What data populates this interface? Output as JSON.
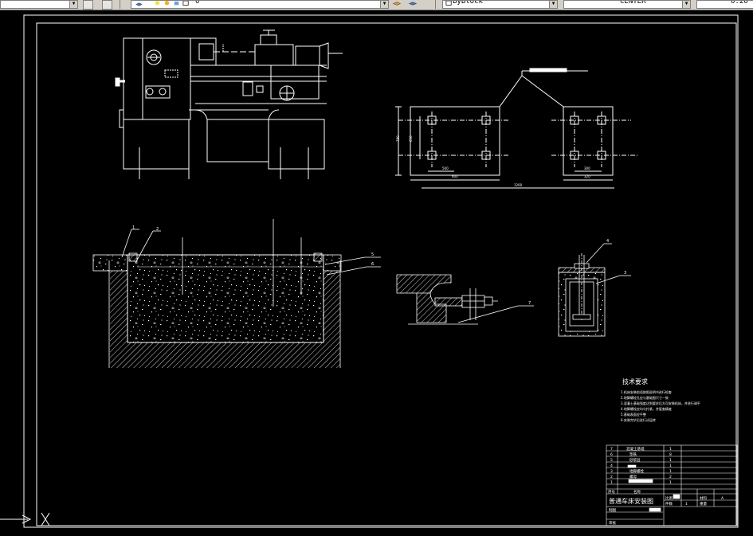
{
  "toolbar": {
    "layer_value": "0",
    "linetype_value": "ByBlock",
    "linetype2_value": "CENTER",
    "lineweight_value": "0.20",
    "icons": [
      "undo-icon",
      "save-icon",
      "layer-icon",
      "bulb-icon",
      "sun-icon",
      "lock-icon",
      "color-icon",
      "layer-prev-icon",
      "match-prop-icon"
    ]
  },
  "drawing": {
    "tech_title": "技术要求",
    "tech_lines": [
      "1.机床安装前须按照说明书进行检查",
      "2.地脚螺栓孔应与基础图尺寸一致",
      "3.混凝土基础强度达到要求后方可安装机床，并进行调平",
      "4.地脚螺栓应均匀拧紧，并复查精度",
      "5.基础表面应平整",
      "6.安装完毕后进行试运转"
    ],
    "table_rows": [
      {
        "no": "7",
        "name": "混凝土基础",
        "qty": "1"
      },
      {
        "no": "6",
        "name": "垫铁",
        "qty": "8"
      },
      {
        "no": "5",
        "name": "砂浆层",
        "qty": "1"
      },
      {
        "no": "4",
        "name": "",
        "qty": "1"
      },
      {
        "no": "3",
        "name": "地脚螺栓",
        "qty": "1"
      },
      {
        "no": "2",
        "name": "螺母",
        "qty": "2"
      },
      {
        "no": "1",
        "name": "",
        "qty": "1"
      }
    ],
    "header_no": "序号",
    "header_name": "名称",
    "title_block_name": "普通车床安装图",
    "scale_label": "比例",
    "sheet_label": "件数",
    "material_label": "材料",
    "weight_label": "重量",
    "scale_value": "1",
    "sheet_value": "1",
    "draw_label": "制图",
    "check_label": "审核",
    "format_value": "A",
    "callouts": [
      "1",
      "2",
      "3",
      "4",
      "5",
      "6",
      "7"
    ],
    "dim_labels": [
      "780",
      "650",
      "1260",
      "600",
      "500",
      "1800",
      "300",
      "320"
    ]
  },
  "ucs": {
    "x_label": "X"
  }
}
